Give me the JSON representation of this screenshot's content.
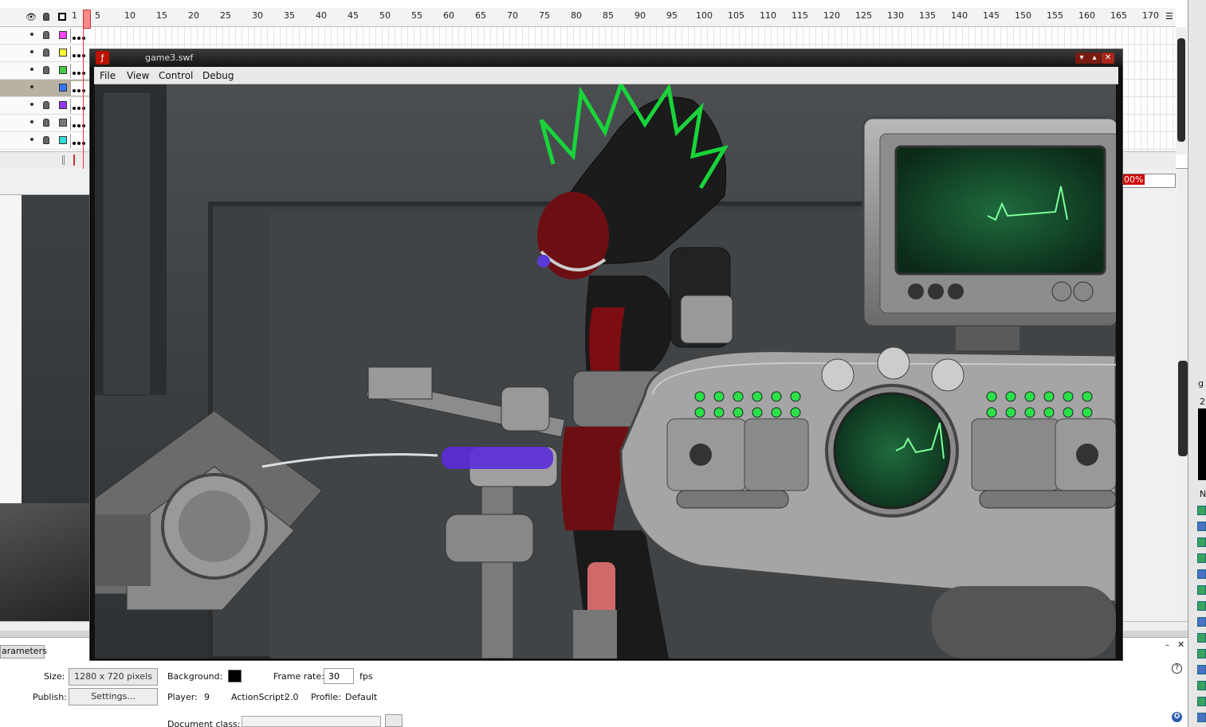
{
  "timeline": {
    "ruler_ticks": [
      "1",
      "5",
      "10",
      "15",
      "20",
      "25",
      "30",
      "35",
      "40",
      "45",
      "50",
      "55",
      "60",
      "65",
      "70",
      "75",
      "80",
      "85",
      "90",
      "95",
      "100",
      "105",
      "110",
      "115",
      "120",
      "125",
      "130",
      "135",
      "140",
      "145",
      "150",
      "155",
      "160",
      "165",
      "170"
    ],
    "layer_colors": [
      "#ff44ff",
      "#ffff33",
      "#44cc44",
      "#3377ff",
      "#9933ff",
      "#777777",
      "#33dddd"
    ]
  },
  "zoom": {
    "value": "00%"
  },
  "swf_window": {
    "title": "game3.swf",
    "menu": [
      "File",
      "View",
      "Control",
      "Debug"
    ]
  },
  "properties": {
    "tab_label": "arameters",
    "size_label": "Size:",
    "size_value": "1280 x 720 pixels",
    "background_label": "Background:",
    "frame_rate_label": "Frame rate:",
    "frame_rate_value": "30",
    "fps_unit": "fps",
    "publish_label": "Publish:",
    "settings_button": "Settings...",
    "player_label": "Player:",
    "player_value": "9",
    "actionscript_label": "ActionScript:",
    "actionscript_value": "2.0",
    "profile_label": "Profile:",
    "profile_value": "Default",
    "document_class_label": "Document class:"
  },
  "right_strip": {
    "fragments": [
      "g",
      "2",
      "N"
    ]
  }
}
